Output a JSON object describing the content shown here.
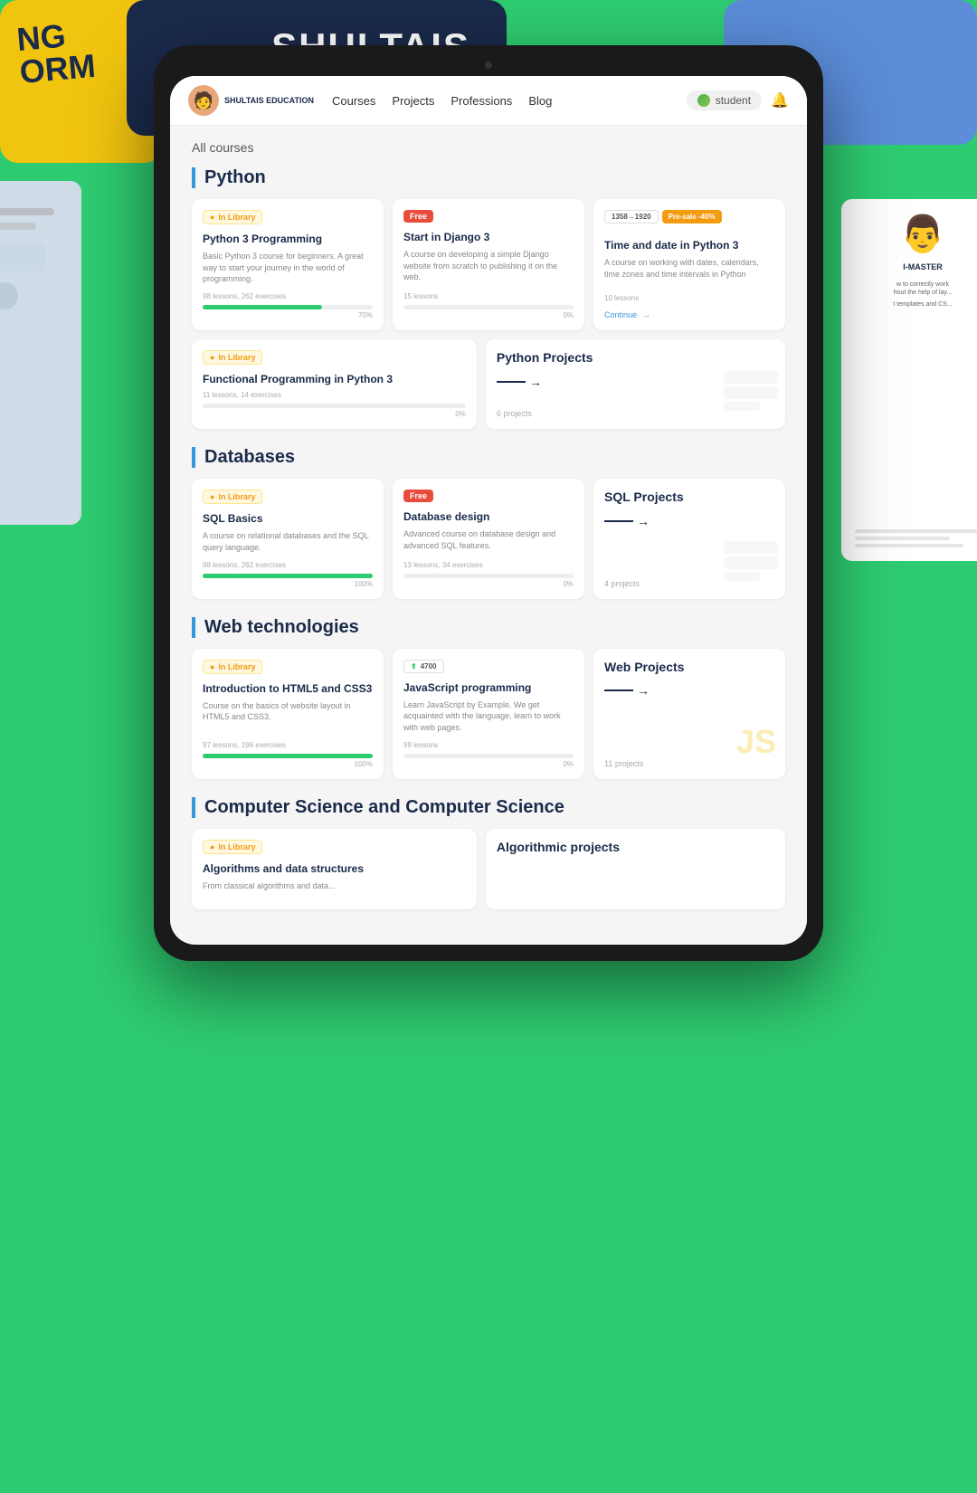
{
  "background": {
    "color": "#2ecc71"
  },
  "nav": {
    "logo_text": "SHULTAIS\nEDUCATION",
    "links": [
      "Courses",
      "Projects",
      "Professions",
      "Blog"
    ],
    "student_name": "student",
    "bell_label": "🔔"
  },
  "page": {
    "title": "All courses"
  },
  "sections": [
    {
      "id": "python",
      "title": "Python",
      "courses": [
        {
          "id": "python3",
          "badge_type": "library",
          "badge_label": "In Library",
          "title": "Python 3 Programming",
          "desc": "Basic Python 3 course for beginners. A great way to start your journey in the world of programming.",
          "meta": "98 lessons, 262 exercises",
          "progress": 70,
          "progress_label": "70%"
        },
        {
          "id": "django3",
          "badge_type": "free",
          "badge_label": "Free",
          "title": "Start in Django 3",
          "desc": "A course on developing a simple Django website from scratch to publishing it on the web.",
          "meta": "15 lessons",
          "progress": 0,
          "progress_label": "0%"
        },
        {
          "id": "timedate",
          "badge_type": "price_sale",
          "badge_price": "1358→1920",
          "badge_sale": "Pre-sale -40%",
          "title": "Time and date in Python 3",
          "desc": "A course on working with dates, calendars, time zones and time intervals in Python",
          "meta": "10 lessons",
          "has_continue": true,
          "continue_label": "Continue"
        }
      ],
      "second_row": [
        {
          "id": "functional",
          "badge_type": "library",
          "badge_label": "In Library",
          "title": "Functional Programming in Python 3",
          "desc": "",
          "meta": "11 lessons, 14 exercises",
          "progress": 0,
          "progress_label": "0%"
        },
        {
          "id": "python-projects",
          "type": "project",
          "title": "Python Projects",
          "count": "6 projects"
        }
      ]
    },
    {
      "id": "databases",
      "title": "Databases",
      "courses": [
        {
          "id": "sql-basics",
          "badge_type": "library",
          "badge_label": "In Library",
          "title": "SQL Basics",
          "desc": "A course on relational databases and the SQL query language.",
          "meta": "98 lessons, 262 exercises",
          "progress": 100,
          "progress_label": "100%"
        },
        {
          "id": "db-design",
          "badge_type": "free",
          "badge_label": "Free",
          "title": "Database design",
          "desc": "Advanced course on database design and advanced SQL features.",
          "meta": "13 lessons, 34 exercises",
          "progress": 0,
          "progress_label": "0%"
        },
        {
          "id": "sql-projects",
          "type": "project",
          "title": "SQL Projects",
          "count": "4 projects"
        }
      ]
    },
    {
      "id": "web",
      "title": "Web technologies",
      "courses": [
        {
          "id": "html5",
          "badge_type": "library",
          "badge_label": "In Library",
          "title": "Introduction to HTML5 and CSS3",
          "desc": "Course on the basics of website layout in HTML5 and CSS3.",
          "meta": "97 lessons, 196 exercises",
          "progress": 100,
          "progress_label": "100%"
        },
        {
          "id": "javascript",
          "badge_type": "views",
          "badge_label": "4700",
          "title": "JavaScript programming",
          "desc": "Learn JavaScript by Example. We get acquainted with the language, learn to work with web pages.",
          "meta": "99 lessons",
          "progress": 0,
          "progress_label": "0%"
        },
        {
          "id": "web-projects",
          "type": "project",
          "title": "Web Projects",
          "count": "11 projects",
          "has_js_deco": true
        }
      ]
    },
    {
      "id": "cs",
      "title": "Computer Science and Computer Science",
      "courses": [
        {
          "id": "algorithms",
          "badge_type": "library",
          "badge_label": "In Library",
          "title": "Algorithms and data structures",
          "desc": "From classical algorithms and data..."
        },
        {
          "id": "algo-projects",
          "type": "project",
          "title": "Algorithmic projects",
          "count": ""
        }
      ]
    }
  ]
}
